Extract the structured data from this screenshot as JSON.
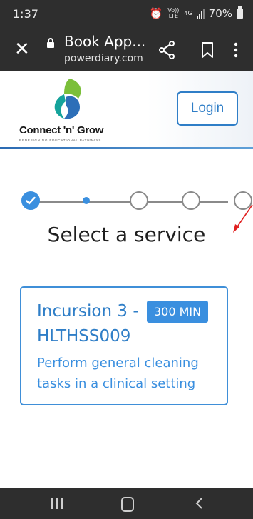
{
  "status_bar": {
    "time": "1:37",
    "network_top": "Vo)) LTE",
    "network_4g": "4G",
    "battery": "70%"
  },
  "browser": {
    "page_title": "Book App...",
    "domain": "powerdiary.com"
  },
  "header": {
    "logo_text": "Connect 'n' Grow",
    "logo_tagline": "REDESIGNING EDUCATIONAL PATHWAYS",
    "login_label": "Login"
  },
  "stepper": {
    "total_steps": 5,
    "completed_steps": 1,
    "current_step": 2
  },
  "page": {
    "title": "Select a service"
  },
  "service": {
    "name": "Incursion 3 -",
    "duration_badge": "300 MIN",
    "code": "HLTHSS009",
    "description": "Perform general cleaning tasks in a clinical setting"
  },
  "colors": {
    "accent": "#3a8fdf",
    "bar": "#2e2e2e",
    "arrow": "#e02020"
  }
}
